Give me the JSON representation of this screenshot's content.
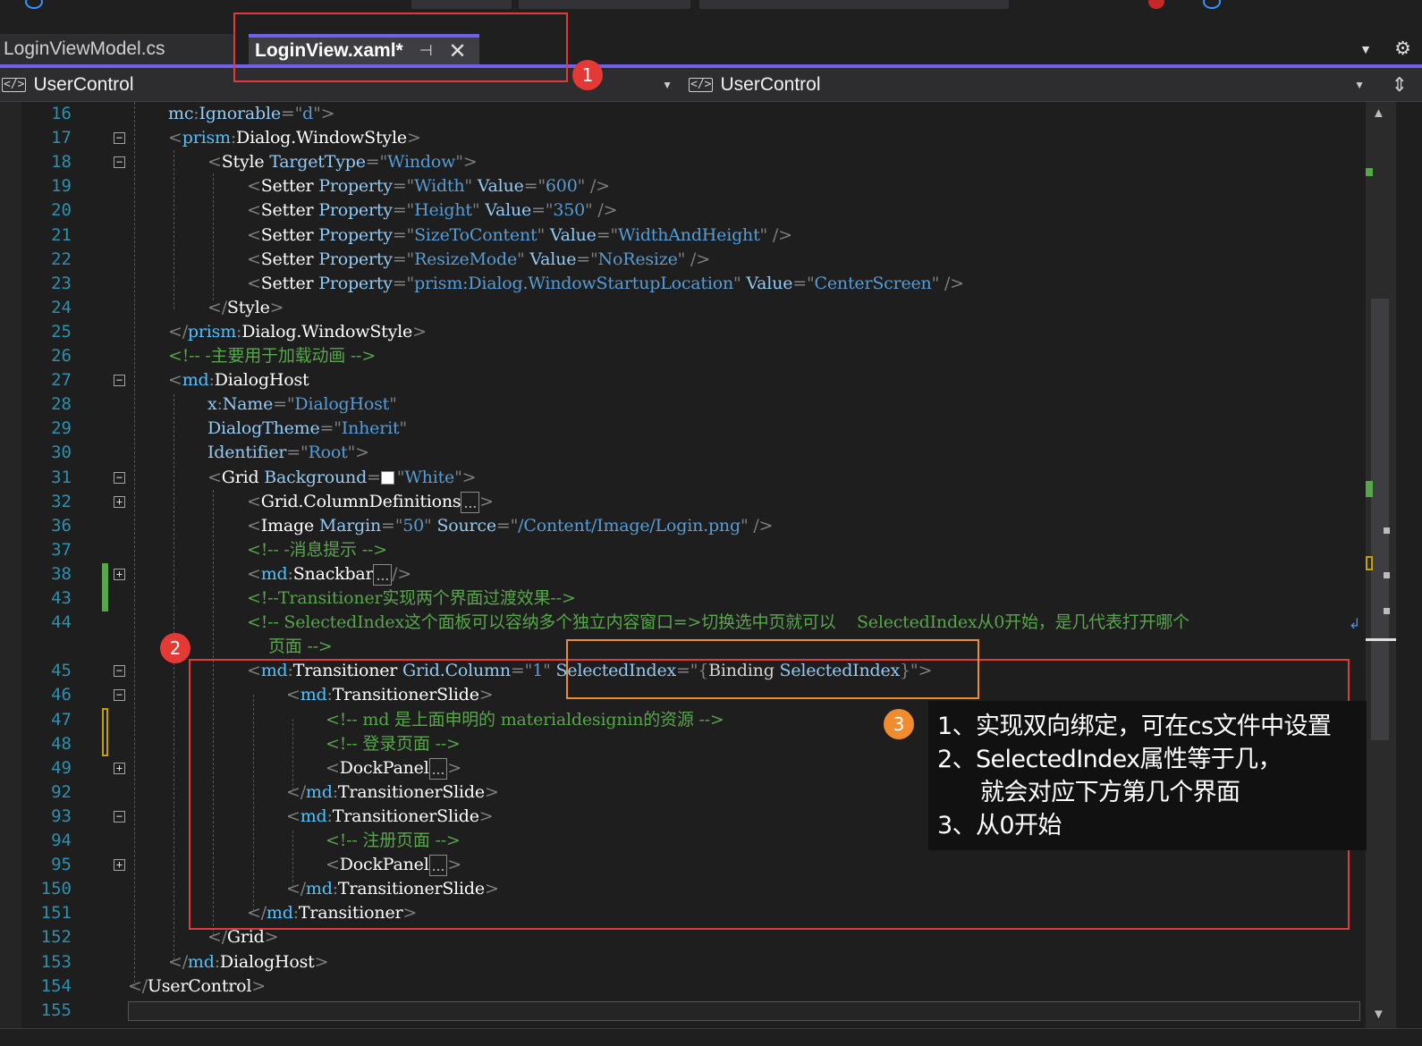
{
  "tabs": [
    {
      "label": "LoginViewModel.cs",
      "active": false
    },
    {
      "label": "LoginView.xaml*",
      "active": true
    }
  ],
  "navigation": {
    "left": {
      "icon": "code-icon",
      "label": "UserControl"
    },
    "right": {
      "icon": "code-icon",
      "label": "UserControl"
    }
  },
  "colors": {
    "accent": "#7160e8",
    "line_number": "#2b91af",
    "xml_delimiter": "#808080",
    "xml_element": "#ffffff",
    "xml_attribute": "#92caf4",
    "xml_string": "#569cd6",
    "comment": "#57a64a",
    "annotation_red": "#e53935",
    "annotation_orange": "#f08c2e"
  },
  "code_lines": [
    {
      "n": "16",
      "segs": [
        [
          "at",
          "mc"
        ],
        [
          "p",
          ":"
        ],
        [
          "at",
          "Ignorable"
        ],
        [
          "p",
          "=\""
        ],
        [
          "st",
          "d"
        ],
        [
          "p",
          "\">"
        ]
      ]
    },
    {
      "n": "17",
      "fold": "-",
      "segs": [
        [
          "p",
          "<"
        ],
        [
          "ns",
          "prism"
        ],
        [
          "p",
          ":"
        ],
        [
          "el",
          "Dialog.WindowStyle"
        ],
        [
          "p",
          ">"
        ]
      ]
    },
    {
      "n": "18",
      "fold": "-",
      "segs": [
        [
          "p",
          "<"
        ],
        [
          "el",
          "Style "
        ],
        [
          "at",
          "TargetType"
        ],
        [
          "p",
          "=\""
        ],
        [
          "st",
          "Window"
        ],
        [
          "p",
          "\">"
        ]
      ]
    },
    {
      "n": "19",
      "segs": [
        [
          "p",
          "<"
        ],
        [
          "el",
          "Setter "
        ],
        [
          "at",
          "Property"
        ],
        [
          "p",
          "=\""
        ],
        [
          "st",
          "Width"
        ],
        [
          "p",
          "\" "
        ],
        [
          "at",
          "Value"
        ],
        [
          "p",
          "=\""
        ],
        [
          "st",
          "600"
        ],
        [
          "p",
          "\" />"
        ]
      ]
    },
    {
      "n": "20",
      "segs": [
        [
          "p",
          "<"
        ],
        [
          "el",
          "Setter "
        ],
        [
          "at",
          "Property"
        ],
        [
          "p",
          "=\""
        ],
        [
          "st",
          "Height"
        ],
        [
          "p",
          "\" "
        ],
        [
          "at",
          "Value"
        ],
        [
          "p",
          "=\""
        ],
        [
          "st",
          "350"
        ],
        [
          "p",
          "\" />"
        ]
      ]
    },
    {
      "n": "21",
      "segs": [
        [
          "p",
          "<"
        ],
        [
          "el",
          "Setter "
        ],
        [
          "at",
          "Property"
        ],
        [
          "p",
          "=\""
        ],
        [
          "st",
          "SizeToContent"
        ],
        [
          "p",
          "\" "
        ],
        [
          "at",
          "Value"
        ],
        [
          "p",
          "=\""
        ],
        [
          "st",
          "WidthAndHeight"
        ],
        [
          "p",
          "\" />"
        ]
      ]
    },
    {
      "n": "22",
      "segs": [
        [
          "p",
          "<"
        ],
        [
          "el",
          "Setter "
        ],
        [
          "at",
          "Property"
        ],
        [
          "p",
          "=\""
        ],
        [
          "st",
          "ResizeMode"
        ],
        [
          "p",
          "\" "
        ],
        [
          "at",
          "Value"
        ],
        [
          "p",
          "=\""
        ],
        [
          "st",
          "NoResize"
        ],
        [
          "p",
          "\" />"
        ]
      ]
    },
    {
      "n": "23",
      "segs": [
        [
          "p",
          "<"
        ],
        [
          "el",
          "Setter "
        ],
        [
          "at",
          "Property"
        ],
        [
          "p",
          "=\""
        ],
        [
          "st",
          "prism:Dialog.WindowStartupLocation"
        ],
        [
          "p",
          "\" "
        ],
        [
          "at",
          "Value"
        ],
        [
          "p",
          "=\""
        ],
        [
          "st",
          "CenterScreen"
        ],
        [
          "p",
          "\" />"
        ]
      ]
    },
    {
      "n": "24",
      "segs": [
        [
          "p",
          "</"
        ],
        [
          "el",
          "Style"
        ],
        [
          "p",
          ">"
        ]
      ]
    },
    {
      "n": "25",
      "segs": [
        [
          "p",
          "</"
        ],
        [
          "ns",
          "prism"
        ],
        [
          "p",
          ":"
        ],
        [
          "el",
          "Dialog.WindowStyle"
        ],
        [
          "p",
          ">"
        ]
      ]
    },
    {
      "n": "26",
      "segs": [
        [
          "cm",
          "<!-- -主要用于加载动画 -->"
        ]
      ]
    },
    {
      "n": "27",
      "fold": "-",
      "segs": [
        [
          "p",
          "<"
        ],
        [
          "ns",
          "md"
        ],
        [
          "p",
          ":"
        ],
        [
          "el",
          "DialogHost"
        ]
      ]
    },
    {
      "n": "28",
      "segs": [
        [
          "at",
          "x"
        ],
        [
          "p",
          ":"
        ],
        [
          "at",
          "Name"
        ],
        [
          "p",
          "=\""
        ],
        [
          "st",
          "DialogHost"
        ],
        [
          "p",
          "\""
        ]
      ]
    },
    {
      "n": "29",
      "segs": [
        [
          "at",
          "DialogTheme"
        ],
        [
          "p",
          "=\""
        ],
        [
          "st",
          "Inherit"
        ],
        [
          "p",
          "\""
        ]
      ]
    },
    {
      "n": "30",
      "segs": [
        [
          "at",
          "Identifier"
        ],
        [
          "p",
          "=\""
        ],
        [
          "st",
          "Root"
        ],
        [
          "p",
          "\">"
        ]
      ]
    },
    {
      "n": "31",
      "fold": "-",
      "segs": [
        [
          "p",
          "<"
        ],
        [
          "el",
          "Grid "
        ],
        [
          "at",
          "Background"
        ],
        [
          "p",
          "="
        ],
        [
          "sw",
          ""
        ],
        [
          "p",
          "\""
        ],
        [
          "st",
          "White"
        ],
        [
          "p",
          "\">"
        ]
      ]
    },
    {
      "n": "32",
      "fold": "+",
      "segs": [
        [
          "p",
          "<"
        ],
        [
          "el",
          "Grid.ColumnDefinitions"
        ],
        [
          "ell",
          "..."
        ],
        [
          "p",
          ">"
        ]
      ]
    },
    {
      "n": "36",
      "segs": [
        [
          "p",
          "<"
        ],
        [
          "el",
          "Image "
        ],
        [
          "at",
          "Margin"
        ],
        [
          "p",
          "=\""
        ],
        [
          "st",
          "50"
        ],
        [
          "p",
          "\" "
        ],
        [
          "at",
          "Source"
        ],
        [
          "p",
          "=\""
        ],
        [
          "st",
          "/Content/Image/Login.png"
        ],
        [
          "p",
          "\" />"
        ]
      ]
    },
    {
      "n": "37",
      "segs": [
        [
          "cm",
          "<!-- -消息提示 -->"
        ]
      ]
    },
    {
      "n": "38",
      "fold": "+",
      "segs": [
        [
          "p",
          "<"
        ],
        [
          "ns",
          "md"
        ],
        [
          "p",
          ":"
        ],
        [
          "el",
          "Snackbar"
        ],
        [
          "ell",
          "..."
        ],
        [
          "p",
          "/>"
        ]
      ]
    },
    {
      "n": "43",
      "segs": [
        [
          "cm",
          "<!--Transitioner实现两个界面过渡效果-->"
        ]
      ]
    },
    {
      "n": "44",
      "segs": [
        [
          "cm",
          "<!-- SelectedIndex这个面板可以容纳多个独立内容窗口=>切换选中页就可以    SelectedIndex从0开始，是几代表打开哪个"
        ]
      ]
    },
    {
      "n": "",
      "segs": [
        [
          "cm",
          "页面 -->"
        ]
      ]
    },
    {
      "n": "45",
      "fold": "-",
      "segs": [
        [
          "p",
          "<"
        ],
        [
          "ns",
          "md"
        ],
        [
          "p",
          ":"
        ],
        [
          "el",
          "Transitioner "
        ],
        [
          "at",
          "Grid.Column"
        ],
        [
          "p",
          "=\""
        ],
        [
          "st",
          "1"
        ],
        [
          "p",
          "\" "
        ],
        [
          "at",
          "SelectedIndex"
        ],
        [
          "p",
          "=\""
        ],
        [
          "p",
          "{"
        ],
        [
          "wh",
          "Binding "
        ],
        [
          "at",
          "SelectedIndex"
        ],
        [
          "p",
          "}\">"
        ]
      ]
    },
    {
      "n": "46",
      "fold": "-",
      "segs": [
        [
          "p",
          "<"
        ],
        [
          "ns",
          "md"
        ],
        [
          "p",
          ":"
        ],
        [
          "el",
          "TransitionerSlide"
        ],
        [
          "p",
          ">"
        ]
      ]
    },
    {
      "n": "47",
      "segs": [
        [
          "cm",
          "<!-- md 是上面申明的 materialdesignin的资源 -->"
        ]
      ]
    },
    {
      "n": "48",
      "segs": [
        [
          "cm",
          "<!-- 登录页面 -->"
        ]
      ]
    },
    {
      "n": "49",
      "fold": "+",
      "segs": [
        [
          "p",
          "<"
        ],
        [
          "el",
          "DockPanel"
        ],
        [
          "ell",
          "..."
        ],
        [
          "p",
          ">"
        ]
      ]
    },
    {
      "n": "92",
      "segs": [
        [
          "p",
          "</"
        ],
        [
          "ns",
          "md"
        ],
        [
          "p",
          ":"
        ],
        [
          "el",
          "TransitionerSlide"
        ],
        [
          "p",
          ">"
        ]
      ]
    },
    {
      "n": "93",
      "fold": "-",
      "segs": [
        [
          "p",
          "<"
        ],
        [
          "ns",
          "md"
        ],
        [
          "p",
          ":"
        ],
        [
          "el",
          "TransitionerSlide"
        ],
        [
          "p",
          ">"
        ]
      ]
    },
    {
      "n": "94",
      "segs": [
        [
          "cm",
          "<!-- 注册页面 -->"
        ]
      ]
    },
    {
      "n": "95",
      "fold": "+",
      "segs": [
        [
          "p",
          "<"
        ],
        [
          "el",
          "DockPanel"
        ],
        [
          "ell",
          "..."
        ],
        [
          "p",
          ">"
        ]
      ]
    },
    {
      "n": "150",
      "segs": [
        [
          "p",
          "</"
        ],
        [
          "ns",
          "md"
        ],
        [
          "p",
          ":"
        ],
        [
          "el",
          "TransitionerSlide"
        ],
        [
          "p",
          ">"
        ]
      ]
    },
    {
      "n": "151",
      "segs": [
        [
          "p",
          "</"
        ],
        [
          "ns",
          "md"
        ],
        [
          "p",
          ":"
        ],
        [
          "el",
          "Transitioner"
        ],
        [
          "p",
          ">"
        ]
      ]
    },
    {
      "n": "152",
      "segs": [
        [
          "p",
          "</"
        ],
        [
          "el",
          "Grid"
        ],
        [
          "p",
          ">"
        ]
      ]
    },
    {
      "n": "153",
      "segs": [
        [
          "p",
          "</"
        ],
        [
          "ns",
          "md"
        ],
        [
          "p",
          ":"
        ],
        [
          "el",
          "DialogHost"
        ],
        [
          "p",
          ">"
        ]
      ]
    },
    {
      "n": "154",
      "segs": [
        [
          "p",
          "</"
        ],
        [
          "el",
          "UserControl"
        ],
        [
          "p",
          ">"
        ]
      ]
    },
    {
      "n": "155",
      "segs": []
    }
  ],
  "annotations": {
    "badge1": "1",
    "badge2": "2",
    "badge3": "3",
    "note_lines": [
      "1、实现双向绑定，可在cs文件中设置",
      "2、SelectedIndex属性等于几，",
      "就会对应下方第几个界面",
      "3、从0开始"
    ]
  }
}
